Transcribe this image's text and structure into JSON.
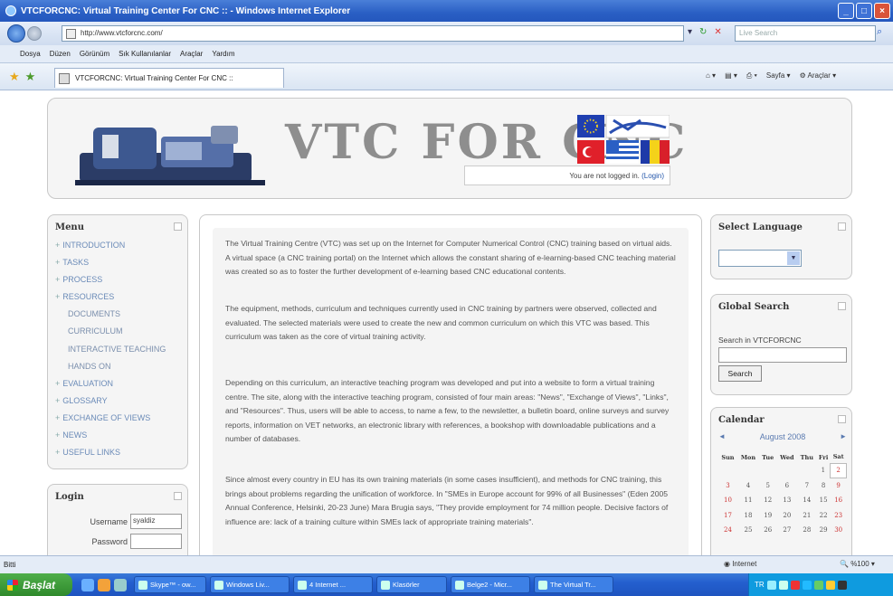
{
  "window": {
    "title": "VTCFORCNC: Virtual Training Center For CNC :: - Windows Internet Explorer"
  },
  "address_bar": {
    "url": "http://www.vtcforcnc.com/",
    "search_placeholder": "Live Search"
  },
  "menu_bar": {
    "items": [
      "Dosya",
      "Düzen",
      "Görünüm",
      "Sık Kullanılanlar",
      "Araçlar",
      "Yardım"
    ]
  },
  "tab": {
    "title": "VTCFORCNC: Virtual Training Center For CNC ::"
  },
  "command_bar": {
    "page_label": "Sayfa",
    "tools_label": "Araçlar"
  },
  "header": {
    "site_title": "VTC FOR CNC",
    "login_text": "You are not logged in.",
    "login_link": "(Login)"
  },
  "menu_block": {
    "title": "Menu",
    "items": [
      {
        "label": "INTRODUCTION",
        "sub": false
      },
      {
        "label": "TASKS",
        "sub": false
      },
      {
        "label": "PROCESS",
        "sub": false
      },
      {
        "label": "RESOURCES",
        "sub": false
      },
      {
        "label": "DOCUMENTS",
        "sub": true
      },
      {
        "label": "CURRICULUM",
        "sub": true
      },
      {
        "label": "INTERACTIVE TEACHING",
        "sub": true
      },
      {
        "label": "HANDS ON",
        "sub": true
      },
      {
        "label": "EVALUATION",
        "sub": false
      },
      {
        "label": "GLOSSARY",
        "sub": false
      },
      {
        "label": "EXCHANGE OF VIEWS",
        "sub": false
      },
      {
        "label": "NEWS",
        "sub": false
      },
      {
        "label": "USEFUL LINKS",
        "sub": false
      }
    ]
  },
  "login_block": {
    "title": "Login",
    "username_label": "Username",
    "username_value": "syaldiz",
    "password_label": "Password"
  },
  "content": {
    "paragraphs": [
      "The Virtual Training Centre (VTC) was set up on the Internet for Computer Numerical Control (CNC) training based on virtual aids. A virtual space (a CNC training portal) on the Internet which allows the constant sharing of e-learning-based CNC teaching material was created so as to foster the further development of e-learning based CNC educational contents.",
      "The equipment, methods, curriculum and techniques currently used in CNC training by partners were observed, collected and evaluated. The selected materials were used to create the new and common curriculum on which this VTC was based. This curriculum was taken as the core of virtual training activity.",
      "Depending on this curriculum, an interactive teaching program was developed and put into a website to form a virtual training centre. The site, along with the interactive teaching program, consisted of four main areas: \"News\", \"Exchange of Views\", \"Links\", and \"Resources\". Thus, users will be able to access, to name a few, to the newsletter, a bulletin board, online surveys and survey reports, information on VET networks, an electronic library with references, a bookshop with downloadable publications and a number of databases.",
      "Since almost every country in EU has its own training materials (in some cases insufficient), and methods for CNC training, this brings about problems regarding the unification of workforce. In \"SMEs in Europe account for 99% of all Businesses\" (Eden 2005 Annual Conference, Helsinki, 20-23 June) Mara Brugia says, \"They provide employment for 74 million people. Decisive factors of influence are: lack of a training culture within SMEs lack of appropriate training materials\"."
    ]
  },
  "language_block": {
    "title": "Select Language"
  },
  "search_block": {
    "title": "Global Search",
    "label": "Search in VTCFORCNC",
    "button": "Search"
  },
  "calendar_block": {
    "title": "Calendar",
    "month": "August 2008",
    "prev": "◄",
    "next": "►",
    "weekdays": [
      "Sun",
      "Mon",
      "Tue",
      "Wed",
      "Thu",
      "Fri",
      "Sat"
    ],
    "weeks": [
      [
        "",
        "",
        "",
        "",
        "",
        "1",
        "2"
      ],
      [
        "3",
        "4",
        "5",
        "6",
        "7",
        "8",
        "9"
      ],
      [
        "10",
        "11",
        "12",
        "13",
        "14",
        "15",
        "16"
      ],
      [
        "17",
        "18",
        "19",
        "20",
        "21",
        "22",
        "23"
      ],
      [
        "24",
        "25",
        "26",
        "27",
        "28",
        "29",
        "30"
      ]
    ],
    "today": "2"
  },
  "status_bar": {
    "left": "Bitti",
    "zone": "Internet",
    "zoom": "%100"
  },
  "taskbar": {
    "start": "Başlat",
    "tasks": [
      "Skype™ - ow...",
      "Windows Liv...",
      "4 Internet ...",
      "Klasörler",
      "Belge2 - Micr...",
      "The Virtual Tr..."
    ],
    "lang": "TR"
  }
}
